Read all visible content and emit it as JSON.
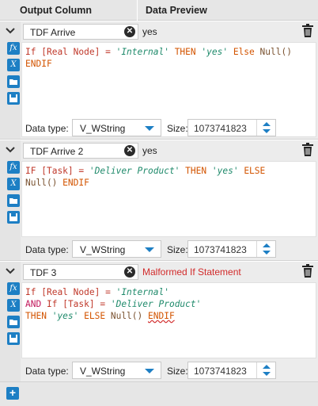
{
  "header": {
    "col_output": "Output Column",
    "col_preview": "Data Preview"
  },
  "rows": [
    {
      "name": "TDF Arrive",
      "preview": "yes",
      "preview_error": false,
      "data_type": "V_WString",
      "size": "1073741823",
      "data_type_label": "Data type:",
      "size_label": "Size:"
    },
    {
      "name": "TDF Arrive 2",
      "preview": "yes",
      "preview_error": false,
      "data_type": "V_WString",
      "size": "1073741823",
      "data_type_label": "Data type:",
      "size_label": "Size:"
    },
    {
      "name": "TDF 3",
      "preview": "Malformed If Statement",
      "preview_error": true,
      "data_type": "V_WString",
      "size": "1073741823",
      "data_type_label": "Data type:",
      "size_label": "Size:"
    }
  ],
  "expressions": {
    "r1": {
      "t1": "If",
      "t2": "[Real Node]",
      "t3": "=",
      "t4": "'Internal'",
      "t5": "THEN",
      "t6": "'yes'",
      "t7": "Else",
      "t8": "Null()",
      "t9": "ENDIF"
    },
    "r2": {
      "t1": "IF",
      "t2": "[Task]",
      "t3": "=",
      "t4": "'Deliver Product'",
      "t5": "THEN",
      "t6": "'yes'",
      "t7": "ELSE",
      "t8": "Null()",
      "t9": "ENDIF"
    },
    "r3": {
      "t1": "If",
      "t2": "[Real Node]",
      "t3": "=",
      "t4": "'Internal'",
      "t5": "AND",
      "t6": "If",
      "t7": "[Task]",
      "t8": "=",
      "t9": "'Deliver Product'",
      "t10": "THEN",
      "t11": "'yes'",
      "t12": "ELSE",
      "t13": "Null()",
      "t14": "ENDIF"
    }
  },
  "tool_icons": [
    "function-icon",
    "variable-icon",
    "folder-icon",
    "save-icon"
  ],
  "footer": {
    "add": "+"
  },
  "colors": {
    "accent": "#1d7fc4",
    "error": "#d22b2b",
    "string": "#1f8a6b",
    "keyword": "#c2185b"
  }
}
